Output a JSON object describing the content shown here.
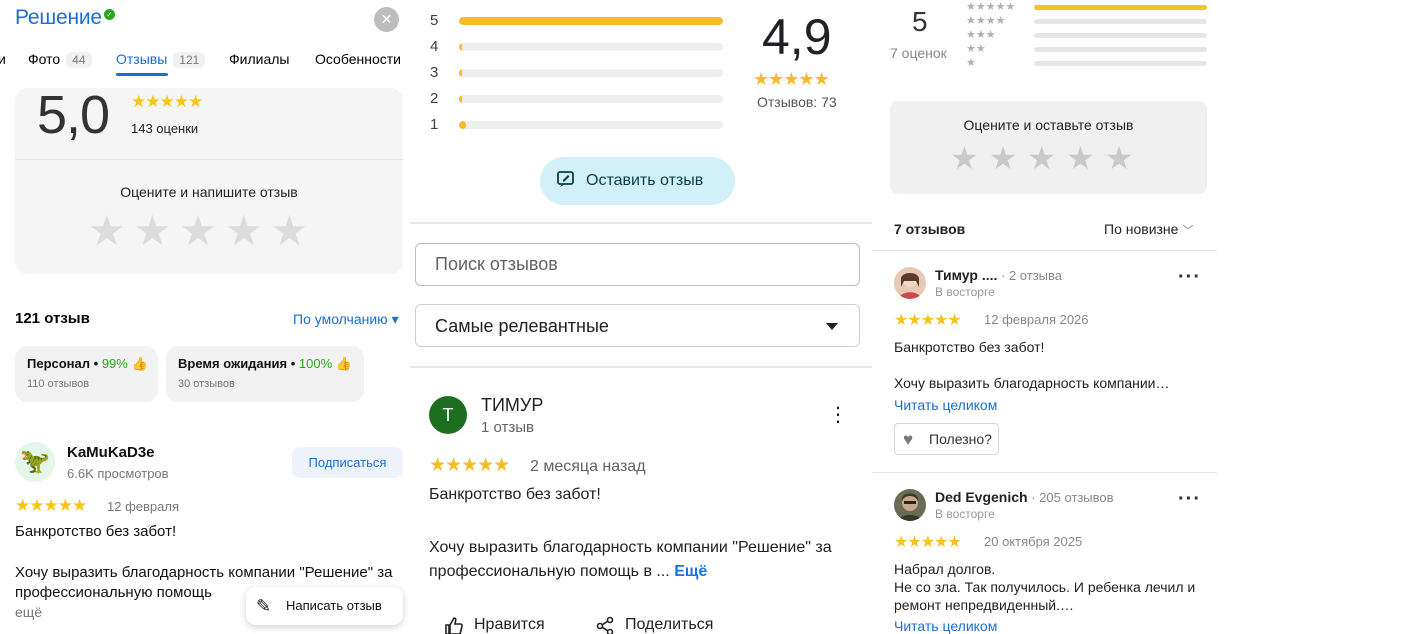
{
  "panel_yandex": {
    "title": "Решение",
    "close_glyph": "✕",
    "tabs": [
      {
        "label": "и"
      },
      {
        "label": "Фото",
        "count": "44"
      },
      {
        "label": "Отзывы",
        "count": "121"
      },
      {
        "label": "Филиалы"
      },
      {
        "label": "Особенности"
      }
    ],
    "rating": "5,0",
    "stars": "★★★★★",
    "ratings_count": "143 оценки",
    "rate_prompt": "Оцените и напишите отзыв",
    "empty_stars": "★★★★★",
    "reviews_count": "121 отзыв",
    "sort_label": "По умолчанию ▾",
    "aspects": [
      {
        "name": "Персонал",
        "percent": "99%",
        "sub": "110 отзывов"
      },
      {
        "name": "Время ожидания",
        "percent": "100%",
        "sub": "30 отзывов"
      }
    ],
    "review": {
      "author": "KaMuKaD3e",
      "views": "6.6K просмотров",
      "subscribe_label": "Подписаться",
      "stars": "★★★★★",
      "date": "12 февраля",
      "title": "Банкротство без забот!",
      "body": "Хочу выразить благодарность компании \"Решение\" за профессиональную помощь",
      "more": "ещё"
    },
    "write_button": "Написать отзыв"
  },
  "panel_google": {
    "distribution": [
      {
        "label": "5",
        "fraction": 1.0
      },
      {
        "label": "4",
        "fraction": 0.01
      },
      {
        "label": "3",
        "fraction": 0.01
      },
      {
        "label": "2",
        "fraction": 0.01
      },
      {
        "label": "1",
        "fraction": 0.025
      }
    ],
    "rating": "4,9",
    "stars": "★★★★★",
    "reviews_total": "Отзывов: 73",
    "leave_review_label": "Оставить отзыв",
    "search_placeholder": "Поиск отзывов",
    "sort_value": "Самые релевантные",
    "review": {
      "avatar_letter": "Т",
      "author": "ТИМУР",
      "author_sub": "1 отзыв",
      "stars": "★★★★★",
      "date": "2 месяца назад",
      "title": "Банкротство без забот!",
      "body": "Хочу выразить благодарность компании \"Решение\" за профессиональную помощь в ...",
      "more": "Ещё",
      "like_label": "Нравится",
      "share_label": "Поделиться"
    }
  },
  "panel_2gis": {
    "rating": "5",
    "ratings_count": "7 оценок",
    "distribution": [
      {
        "stars": "★★★★★",
        "fraction": 1.0
      },
      {
        "stars": "★★★★",
        "fraction": 0.0
      },
      {
        "stars": "★★★",
        "fraction": 0.0
      },
      {
        "stars": "★★",
        "fraction": 0.0
      },
      {
        "stars": "★",
        "fraction": 0.0
      }
    ],
    "rate_prompt": "Оцените и оставьте отзыв",
    "empty_stars": "★★★★★",
    "reviews_count": "7 отзывов",
    "sort_label": "По новизне",
    "reviews": [
      {
        "author": "Тимур ....",
        "author_meta": " · 2 отзыва",
        "mood": "В восторге",
        "stars": "★★★★★",
        "date": "12 февраля 2026",
        "title": "Банкротство без забот!",
        "body": "Хочу выразить благодарность компании…",
        "read_more": "Читать целиком",
        "useful_label": "Полезно?"
      },
      {
        "author": "Ded Evgenich",
        "author_meta": " · 205 отзывов",
        "mood": "В восторге",
        "stars": "★★★★★",
        "date": "20 октября 2025",
        "body_lines": [
          "Набрал долгов.",
          "Не со зла. Так получилось. И ребенка лечил и",
          "ремонт непредвиденный.…"
        ],
        "read_more": "Читать целиком"
      }
    ]
  }
}
